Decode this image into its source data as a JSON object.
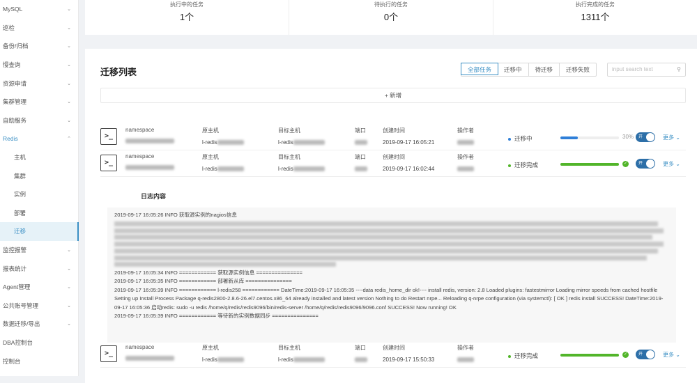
{
  "sidebar": {
    "items": [
      {
        "label": "MySQL",
        "chev": "⌄"
      },
      {
        "label": "巡检",
        "chev": "⌄"
      },
      {
        "label": "备份/归档",
        "chev": "⌄"
      },
      {
        "label": "慢查询",
        "chev": "⌄"
      },
      {
        "label": "资源申请",
        "chev": "⌄"
      },
      {
        "label": "集群管理",
        "chev": "⌄"
      },
      {
        "label": "自助服务",
        "chev": "⌄"
      },
      {
        "label": "Redis",
        "chev": "⌃"
      }
    ],
    "sub": [
      "主机",
      "集群",
      "实例",
      "部署",
      "迁移"
    ],
    "items2": [
      {
        "label": "监控报警",
        "chev": "⌄"
      },
      {
        "label": "报表统计",
        "chev": "⌄"
      },
      {
        "label": "Agent管理",
        "chev": "⌄"
      },
      {
        "label": "公共账号管理",
        "chev": "⌄"
      },
      {
        "label": "数据迁移/导出",
        "chev": "⌄"
      },
      {
        "label": "DBA控制台",
        "chev": ""
      },
      {
        "label": "控制台",
        "chev": ""
      }
    ]
  },
  "stats": [
    {
      "label": "执行中的任务",
      "value": "1个"
    },
    {
      "label": "待执行的任务",
      "value": "0个"
    },
    {
      "label": "执行完成的任务",
      "value": "1311个"
    }
  ],
  "main": {
    "title": "迁移列表",
    "tabs": [
      "全部任务",
      "迁移中",
      "待迁移",
      "迁移失败"
    ],
    "search_placeholder": "input search text",
    "add_label": "+ 新增",
    "headers": {
      "ns": "namespace",
      "src": "原主机",
      "dst": "目标主机",
      "port": "端口",
      "created": "创建时间",
      "operator": "操作者"
    },
    "rows": [
      {
        "src": "l-redis",
        "dst": "l-redis",
        "created": "2019-09-17 16:05:21",
        "status": "迁移中",
        "status_color": "#2f7fd8",
        "progress": 30,
        "pct": "30%",
        "toggle": "开",
        "more": "更多 ⌄"
      },
      {
        "src": "l-redis",
        "dst": "l-redis",
        "created": "2019-09-17 16:02:44",
        "status": "迁移完成",
        "status_color": "#52b52a",
        "progress": 100,
        "toggle": "开",
        "more": "更多 ⌄"
      },
      {
        "src": "l-redis",
        "dst": "l-redis",
        "created": "2019-09-17 15:50:33",
        "status": "迁移完成",
        "status_color": "#52b52a",
        "progress": 100,
        "toggle": "开",
        "more": "更多 ⌄"
      }
    ],
    "log_title": "日志内容",
    "log_first": "2019-09-17 16:05:26 INFO 获取源实例的nagios信息",
    "log_lines": [
      "2019-09-17 16:05:34 INFO ============ 获取源实例信息 ===============",
      "2019-09-17 16:05:35 INFO ============ 部署新从库 ===============",
      "2019-09-17 16:05:39 INFO ============ l-redis258 ============ DateTime:2019-09-17 16:05:35 ----data redis_home_dir ok!---- install redis, version: 2.8 Loaded plugins: fastestmirror Loading mirror speeds from cached hostfile Setting up Install Process Package q-redis2800-2.8.6-26.el7.centos.x86_64 already installed and latest version Nothing to do Restart nrpe... Reloading q-nrpe configuration (via systemctl): [ OK ] redis install SUCCESS! DateTime:2019-09-17 16:05:36 启动redis: sudo -u redis /home/q/redis/redis9096/bin/redis-server /home/q/redis/redis9096/9096.conf SUCCESS! Now running! OK",
      "2019-09-17 16:05:39 INFO ============ 等待新的实例数据同步 ==============="
    ]
  }
}
